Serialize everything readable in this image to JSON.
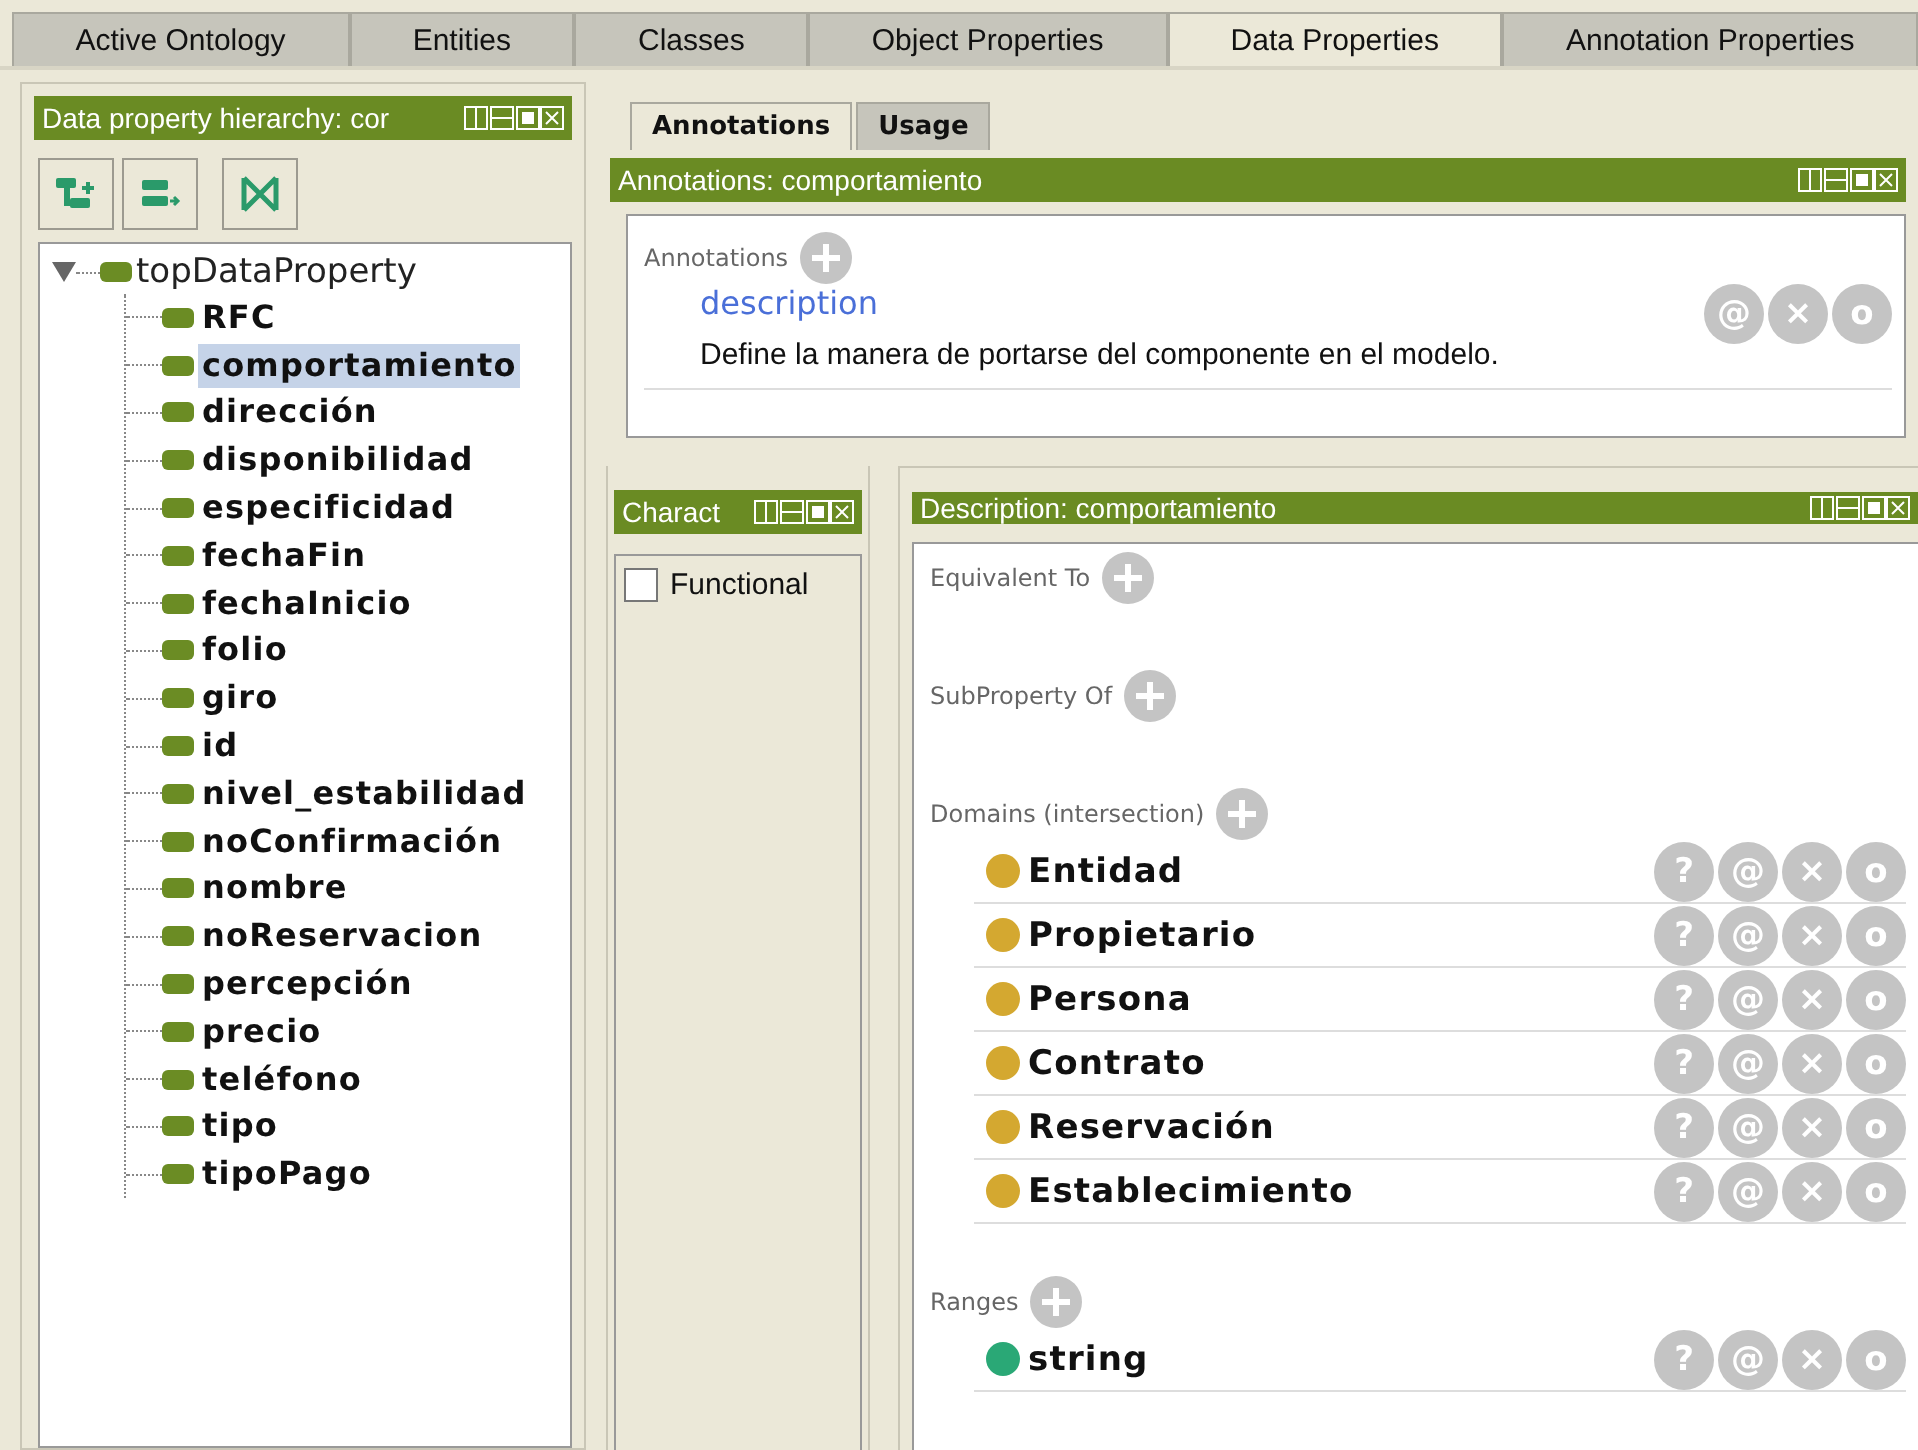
{
  "tabs": [
    {
      "label": "Active Ontology",
      "selected": false
    },
    {
      "label": "Entities",
      "selected": false
    },
    {
      "label": "Classes",
      "selected": false
    },
    {
      "label": "Object Properties",
      "selected": false
    },
    {
      "label": "Data Properties",
      "selected": true
    },
    {
      "label": "Annotation Properties",
      "selected": false
    }
  ],
  "hierarchy_panel": {
    "title": "Data property hierarchy: cor",
    "tree": {
      "label": "topDataProperty",
      "expanded": true,
      "children": [
        {
          "label": "RFC",
          "selected": false
        },
        {
          "label": "comportamiento",
          "selected": true
        },
        {
          "label": "dirección",
          "selected": false
        },
        {
          "label": "disponibilidad",
          "selected": false
        },
        {
          "label": "especificidad",
          "selected": false
        },
        {
          "label": "fechaFin",
          "selected": false
        },
        {
          "label": "fechaInicio",
          "selected": false
        },
        {
          "label": "folio",
          "selected": false
        },
        {
          "label": "giro",
          "selected": false
        },
        {
          "label": "id",
          "selected": false
        },
        {
          "label": "nivel_estabilidad",
          "selected": false
        },
        {
          "label": "noConfirmación",
          "selected": false
        },
        {
          "label": "nombre",
          "selected": false
        },
        {
          "label": "noReservacion",
          "selected": false
        },
        {
          "label": "percepción",
          "selected": false
        },
        {
          "label": "precio",
          "selected": false
        },
        {
          "label": "teléfono",
          "selected": false
        },
        {
          "label": "tipo",
          "selected": false
        },
        {
          "label": "tipoPago",
          "selected": false
        }
      ]
    }
  },
  "annotations_view": {
    "subtabs": [
      {
        "label": "Annotations",
        "selected": true
      },
      {
        "label": "Usage",
        "selected": false
      }
    ],
    "title": "Annotations: comportamiento",
    "section_label": "Annotations",
    "items": [
      {
        "property": "description",
        "value": "Define la manera de portarse del componente en el modelo.",
        "actions": [
          "@",
          "×",
          "o"
        ]
      }
    ]
  },
  "characteristics_panel": {
    "title": "Charact",
    "items": [
      {
        "label": "Functional",
        "checked": false
      }
    ]
  },
  "description_panel": {
    "title": "Description: comportamiento",
    "sections": [
      {
        "label": "Equivalent To"
      },
      {
        "label": "SubProperty Of"
      },
      {
        "label": "Domains (intersection)",
        "items": [
          {
            "label": "Entidad",
            "color": "#d4a830",
            "actions": [
              "?",
              "@",
              "×",
              "o"
            ]
          },
          {
            "label": "Propietario",
            "color": "#d4a830",
            "actions": [
              "?",
              "@",
              "×",
              "o"
            ]
          },
          {
            "label": "Persona",
            "color": "#d4a830",
            "actions": [
              "?",
              "@",
              "×",
              "o"
            ]
          },
          {
            "label": "Contrato",
            "color": "#d4a830",
            "actions": [
              "?",
              "@",
              "×",
              "o"
            ]
          },
          {
            "label": "Reservación",
            "color": "#d4a830",
            "actions": [
              "?",
              "@",
              "×",
              "o"
            ]
          },
          {
            "label": "Establecimiento",
            "color": "#d4a830",
            "actions": [
              "?",
              "@",
              "×",
              "o"
            ]
          }
        ]
      },
      {
        "label": "Ranges",
        "items": [
          {
            "label": "string",
            "color": "#2aa876",
            "actions": [
              "?",
              "@",
              "×",
              "o"
            ]
          }
        ]
      }
    ]
  }
}
